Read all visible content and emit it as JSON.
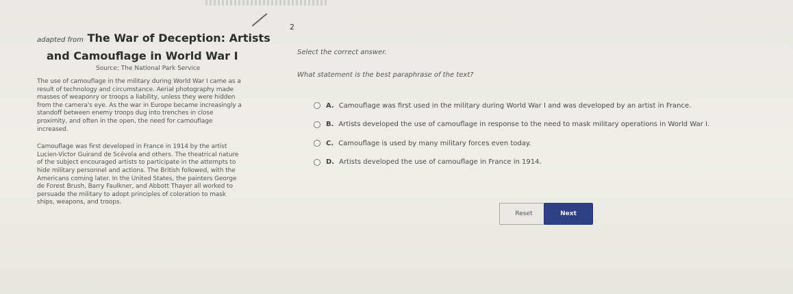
{
  "page_number": "2",
  "passage": {
    "adapted_label": "adapted from",
    "title_line1": "The War of Deception: Artists",
    "title_line2": "and Camouflage in World War I",
    "source": "Source: The National Park Service",
    "paragraph1": "The use of camouflage in the military during World War I came as a result of technology and circumstance. Aerial photography made masses of weaponry or troops a liability, unless they were hidden from the camera's eye. As the war in Europe became increasingly a standoff between enemy troops dug into trenches in close proximity, and often in the open, the need for camouflage increased.",
    "paragraph2": "Camouflage was first developed in France in 1914 by the artist Lucien-Victor Guirand de Scévola and others. The theatrical nature of the subject encouraged artists to participate in the attempts to hide military personnel and actions. The British followed, with the Americans coming later. In the United States, the painters George de Forest Brush, Barry Faulkner, and Abbott Thayer all worked to persuade the military to adopt principles of coloration to mask ships, weapons, and troops."
  },
  "question": {
    "instruction": "Select the correct answer.",
    "prompt": "What statement is the best paraphrase of the text?",
    "choices": [
      {
        "letter": "A.",
        "text": "Camouflage was first used in the military during World War I and was developed by an artist in France."
      },
      {
        "letter": "B.",
        "text": "Artists developed the use of camouflage in response to the need to mask military operations in World War I."
      },
      {
        "letter": "C.",
        "text": "Camouflage is used by many military forces even today."
      },
      {
        "letter": "D.",
        "text": "Artists developed the use of camouflage in France in 1914."
      }
    ]
  },
  "buttons": {
    "reset": "Reset",
    "next": "Next"
  },
  "colors": {
    "next_button": "#2f3f86",
    "background": "#ecebe7"
  }
}
